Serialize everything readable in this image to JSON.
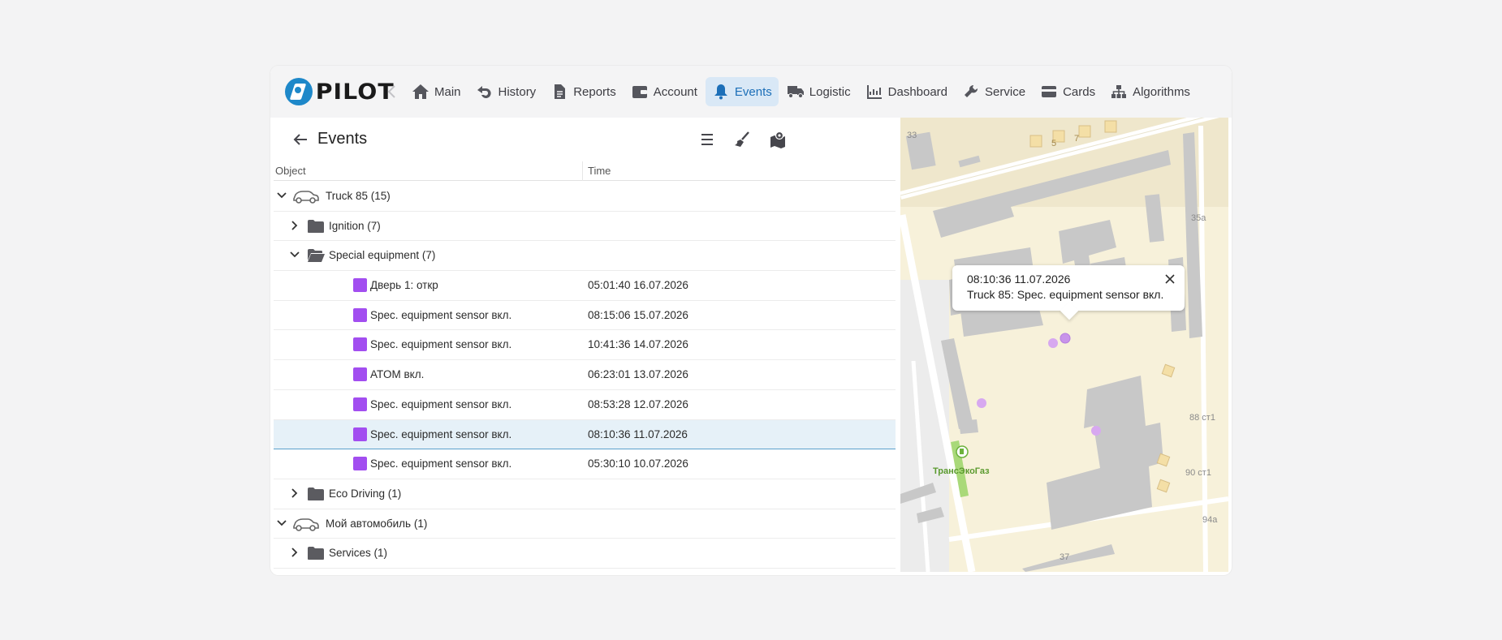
{
  "brand": {
    "logo_text": "PILOT"
  },
  "nav": {
    "items": [
      {
        "label": "Main",
        "icon": "home-icon"
      },
      {
        "label": "History",
        "icon": "history-icon"
      },
      {
        "label": "Reports",
        "icon": "document-icon"
      },
      {
        "label": "Account",
        "icon": "wallet-icon"
      },
      {
        "label": "Events",
        "icon": "bell-icon",
        "active": true
      },
      {
        "label": "Logistic",
        "icon": "truck-icon"
      },
      {
        "label": "Dashboard",
        "icon": "chart-icon"
      },
      {
        "label": "Service",
        "icon": "wrench-icon"
      },
      {
        "label": "Cards",
        "icon": "card-icon"
      },
      {
        "label": "Algorithms",
        "icon": "sitemap-icon"
      }
    ]
  },
  "panel": {
    "title": "Events",
    "columns": {
      "object": "Object",
      "time": "Time"
    }
  },
  "tree": {
    "truck": {
      "label": "Truck 85 (15)"
    },
    "ignition": {
      "label": "Ignition (7)"
    },
    "special": {
      "label": "Special equipment (7)"
    },
    "events": [
      {
        "label": "Дверь 1: откр",
        "time": "05:01:40 16.07.2026"
      },
      {
        "label": "Spec. equipment sensor вкл.",
        "time": "08:15:06 15.07.2026"
      },
      {
        "label": "Spec. equipment sensor вкл.",
        "time": "10:41:36 14.07.2026"
      },
      {
        "label": "ATOM вкл.",
        "time": "06:23:01 13.07.2026"
      },
      {
        "label": "Spec. equipment sensor вкл.",
        "time": "08:53:28 12.07.2026"
      },
      {
        "label": "Spec. equipment sensor вкл.",
        "time": "08:10:36 11.07.2026",
        "selected": true
      },
      {
        "label": "Spec. equipment sensor вкл.",
        "time": "05:30:10 10.07.2026"
      }
    ],
    "eco": {
      "label": "Eco Driving (1)"
    },
    "mycar": {
      "label": "Мой автомобиль (1)"
    },
    "services": {
      "label": "Services (1)"
    }
  },
  "map": {
    "popup": {
      "time": "08:10:36 11.07.2026",
      "text": "Truck 85: Spec. equipment sensor вкл."
    },
    "labels": {
      "l33": "33",
      "l5": "5",
      "l7": "7",
      "l35a": "35а",
      "l88": "88 ст1",
      "l90": "90 ст1",
      "l94a": "94а",
      "l37": "37",
      "gas": "ТрансЭкоГаз"
    },
    "marker_color": "#d7a8f0"
  },
  "colors": {
    "accent": "#1c6fb8",
    "event": "#a24ef0",
    "selected_row": "#e6f1f8"
  }
}
